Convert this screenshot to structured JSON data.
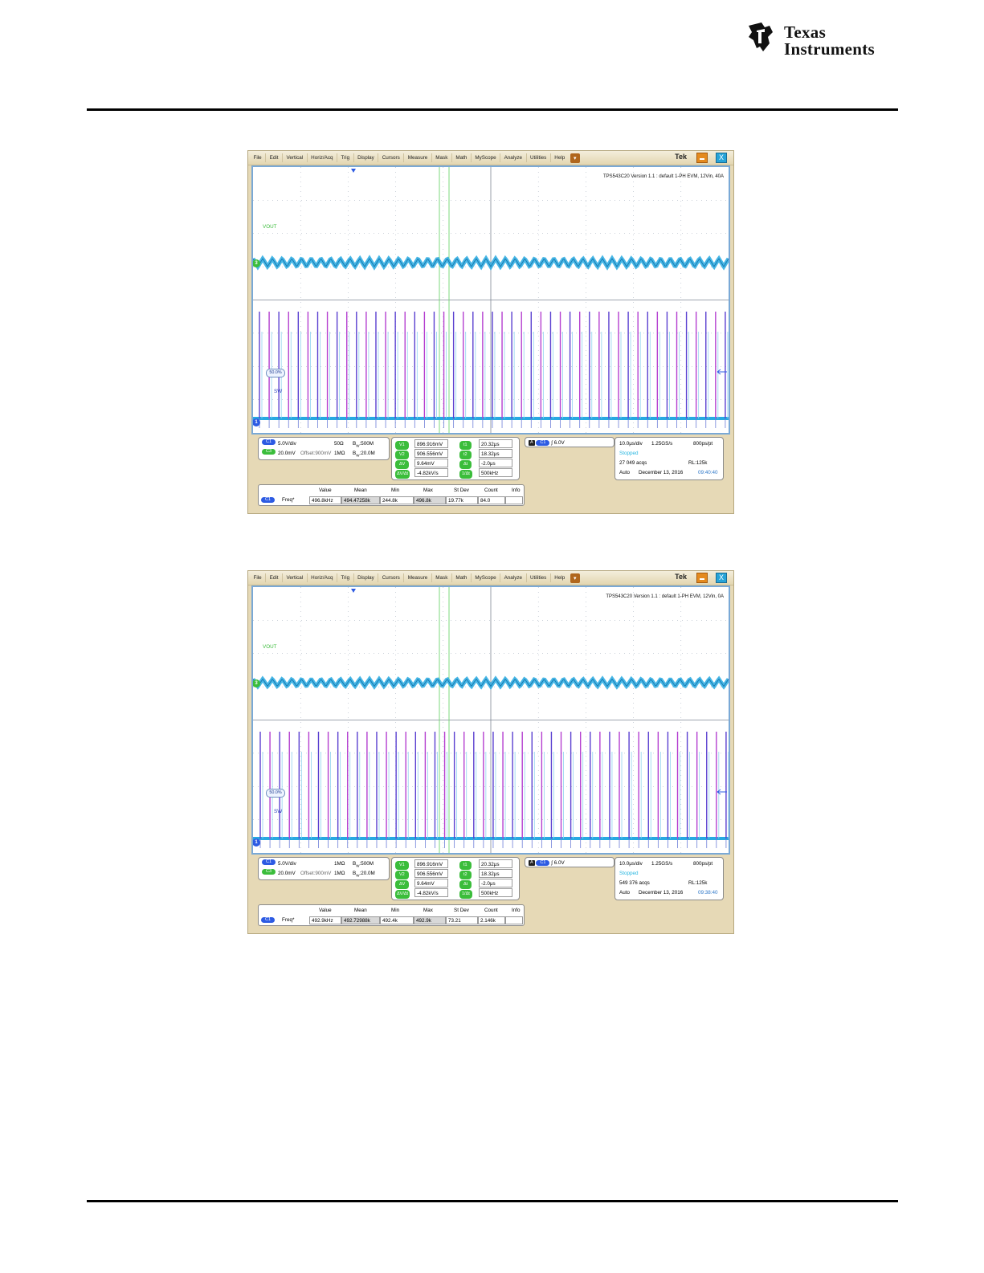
{
  "header": {
    "logo_line1": "Texas",
    "logo_line2": "Instruments"
  },
  "menu": {
    "items": [
      "File",
      "Edit",
      "Vertical",
      "Horiz/Acq",
      "Trig",
      "Display",
      "Cursors",
      "Measure",
      "Mask",
      "Math",
      "MyScope",
      "Analyze",
      "Utilities",
      "Help"
    ],
    "brand": "Tek",
    "close_glyph": "X"
  },
  "scopes": [
    {
      "note": "TPS543C20 Version 1.1 : default 1-PH EVM, 12Vin, 40A",
      "vout_label": "VOUT",
      "sw_label": "SW",
      "cursor_tag": "50.0%",
      "marker_vout": "3",
      "marker_sw": "1",
      "vertical": {
        "c1_pill": "C1",
        "c1_scale": "5.0V/div",
        "c1_impedance": "50Ω",
        "c1_bw": "B",
        "c1_bw_sub": "W",
        "c1_bw_val": ":500M",
        "c3_pill": "C3",
        "c3_scale": "20.0mV",
        "c3_offset": "Offset:900mV",
        "c3_impedance": "1MΩ",
        "c3_bw": "B",
        "c3_bw_sub": "W",
        "c3_bw_val": ":20.0M"
      },
      "cursor_readout": {
        "v1_pill": "V1",
        "v1": "896.916mV",
        "v2_pill": "V2",
        "v2": "906.556mV",
        "dv_pill": "ΔV",
        "dv": "9.64mV",
        "slope_pill": "ΔV/Δt",
        "slope": "-4.82kV/s",
        "t1_pill": "t1",
        "t1": "20.32μs",
        "t2_pill": "t2",
        "t2": "18.32μs",
        "dt_pill": "Δt",
        "dt": "-2.0μs",
        "inv_pill": "1/Δt",
        "inv": "500kHz"
      },
      "trigger": {
        "mode_pill": "A",
        "source_pill": "C1",
        "level": "6.0V"
      },
      "acquisition": {
        "timebase": "10.0μs/div",
        "sample_rate": "1.25GS/s",
        "resolution": "800ps/pt",
        "state": "Stopped",
        "acqs": "27 049 acqs",
        "record_length": "RL:125k",
        "mode": "Auto",
        "date": "December 13, 2016",
        "time": "09:40:40"
      },
      "stats": {
        "headers": [
          "Value",
          "Mean",
          "Min",
          "Max",
          "St Dev",
          "Count",
          "Info"
        ],
        "source_pill": "C1",
        "measurement": "Freq*",
        "value": "496.8kHz",
        "mean": "494.47258k",
        "min": "244.8k",
        "max": "496.8k",
        "stdev": "19.77k",
        "count": "84.0",
        "info": ""
      }
    },
    {
      "note": "TPS543C20 Version 1.1 : default 1-PH EVM, 12Vin, 0A",
      "vout_label": "VOUT",
      "sw_label": "SW",
      "cursor_tag": "50.0%",
      "marker_vout": "3",
      "marker_sw": "1",
      "vertical": {
        "c1_pill": "C1",
        "c1_scale": "5.0V/div",
        "c1_impedance": "1MΩ",
        "c1_bw": "B",
        "c1_bw_sub": "W",
        "c1_bw_val": ":500M",
        "c3_pill": "C3",
        "c3_scale": "20.0mV",
        "c3_offset": "Offset:900mV",
        "c3_impedance": "1MΩ",
        "c3_bw": "B",
        "c3_bw_sub": "W",
        "c3_bw_val": ":20.0M"
      },
      "cursor_readout": {
        "v1_pill": "V1",
        "v1": "896.916mV",
        "v2_pill": "V2",
        "v2": "906.556mV",
        "dv_pill": "ΔV",
        "dv": "9.64mV",
        "slope_pill": "ΔV/Δt",
        "slope": "-4.82kV/s",
        "t1_pill": "t1",
        "t1": "20.32μs",
        "t2_pill": "t2",
        "t2": "18.32μs",
        "dt_pill": "Δt",
        "dt": "-2.0μs",
        "inv_pill": "1/Δt",
        "inv": "500kHz"
      },
      "trigger": {
        "mode_pill": "A",
        "source_pill": "C1",
        "level": "6.0V"
      },
      "acquisition": {
        "timebase": "10.0μs/div",
        "sample_rate": "1.25GS/s",
        "resolution": "800ps/pt",
        "state": "Stopped",
        "acqs": "549 376 acqs",
        "record_length": "RL:125k",
        "mode": "Auto",
        "date": "December 13, 2016",
        "time": "09:38:40"
      },
      "stats": {
        "headers": [
          "Value",
          "Mean",
          "Min",
          "Max",
          "St Dev",
          "Count",
          "Info"
        ],
        "source_pill": "C1",
        "measurement": "Freq*",
        "value": "492.9kHz",
        "mean": "492.72988k",
        "min": "492.4k",
        "max": "492.9k",
        "stdev": "73.21",
        "count": "2.146k",
        "info": ""
      }
    }
  ],
  "colors": {
    "vout_trace": "#27a9e1",
    "sw_trace_a": "#5a3fd0",
    "sw_trace_b": "#b43fd0",
    "cursor": "#6fd46f",
    "grid": "#9aa4b5",
    "frame": "#e6d9b6"
  }
}
